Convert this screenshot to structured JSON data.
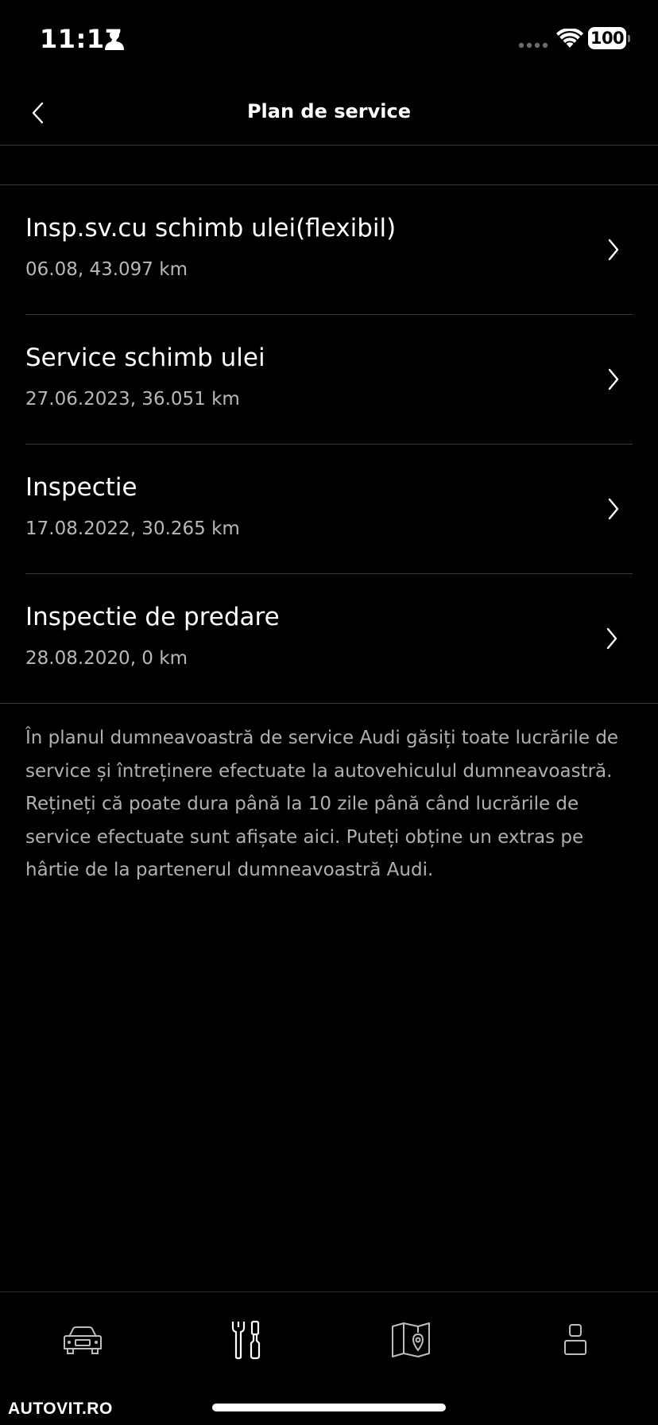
{
  "status_bar": {
    "time": "11:17",
    "battery": "100",
    "icons": [
      "person-icon",
      "signal-dots-icon",
      "wifi-icon",
      "battery-icon"
    ]
  },
  "header": {
    "title": "Plan de service",
    "back_icon": "chevron-left-icon"
  },
  "services": [
    {
      "title": "Insp.sv.cu schimb ulei(flexibil)",
      "subtitle": "06.08, 43.097 km"
    },
    {
      "title": "Service schimb ulei",
      "subtitle": "27.06.2023, 36.051 km"
    },
    {
      "title": "Inspectie",
      "subtitle": "17.08.2022, 30.265 km"
    },
    {
      "title": "Inspectie de predare",
      "subtitle": "28.08.2020, 0 km"
    }
  ],
  "info_text": "În planul dumneavoastră de service Audi găsiți toate lucrările de service și întreținere efectuate la autovehiculul dumneavoastră. Rețineți că poate dura până la 10 zile până când lucrările de service efectuate sunt afișate aici. Puteți obține un extras pe hârtie de la partenerul dumneavoastră Audi.",
  "tabs": [
    {
      "icon": "car-icon"
    },
    {
      "icon": "wrench-screwdriver-icon"
    },
    {
      "icon": "map-pin-icon"
    },
    {
      "icon": "profile-icon"
    }
  ],
  "watermark": "AUTOVIT.RO"
}
